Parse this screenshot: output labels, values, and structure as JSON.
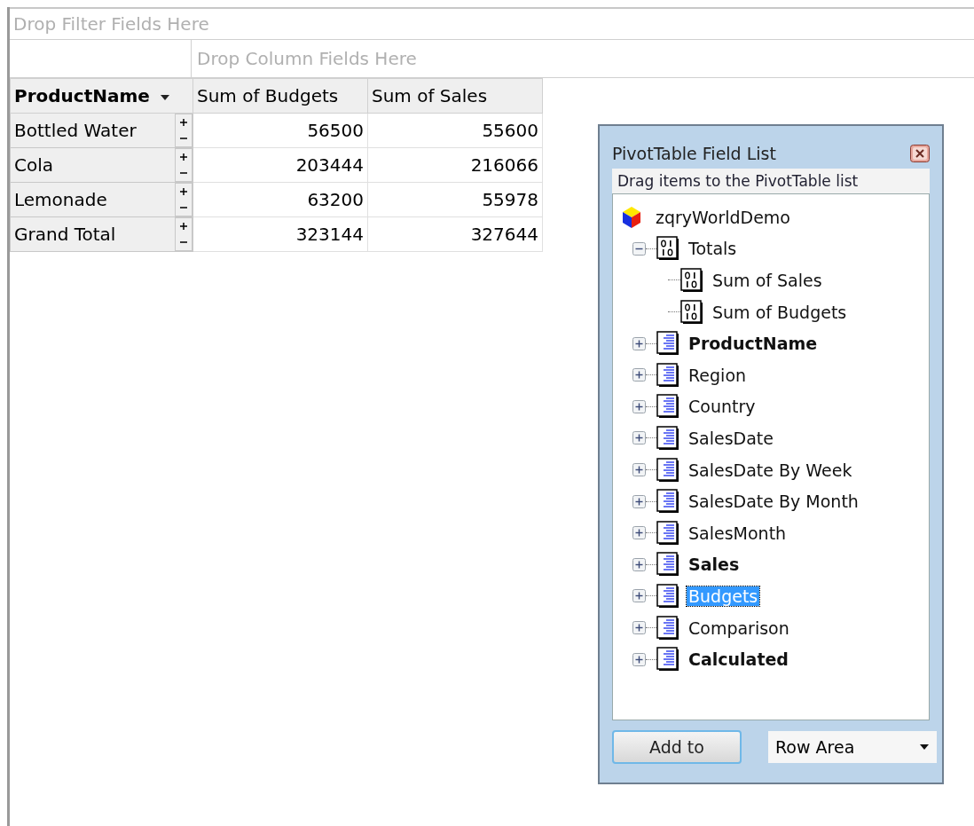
{
  "pivot": {
    "filter_placeholder": "Drop Filter Fields Here",
    "column_placeholder": "Drop Column Fields Here",
    "row_field": "ProductName",
    "columns": [
      "Sum of Budgets",
      "Sum of Sales"
    ],
    "rows": [
      {
        "label": "Bottled Water",
        "values": [
          "56500",
          "55600"
        ]
      },
      {
        "label": "Cola",
        "values": [
          "203444",
          "216066"
        ]
      },
      {
        "label": "Lemonade",
        "values": [
          "63200",
          "55978"
        ]
      },
      {
        "label": "Grand Total",
        "values": [
          "323144",
          "327644"
        ]
      }
    ]
  },
  "field_list": {
    "title": "PivotTable Field List",
    "hint": "Drag items to the PivotTable list",
    "root": {
      "label": "zqryWorldDemo",
      "children": [
        {
          "kind": "measure-group",
          "label": "Totals",
          "expanded": true,
          "bold": false,
          "selected": false,
          "children": [
            {
              "kind": "measure",
              "label": "Sum of Sales",
              "bold": false,
              "selected": false
            },
            {
              "kind": "measure",
              "label": "Sum of Budgets",
              "bold": false,
              "selected": false
            }
          ]
        },
        {
          "kind": "dimension",
          "label": "ProductName",
          "expanded": false,
          "bold": true,
          "selected": false
        },
        {
          "kind": "dimension",
          "label": "Region",
          "expanded": false,
          "bold": false,
          "selected": false
        },
        {
          "kind": "dimension",
          "label": "Country",
          "expanded": false,
          "bold": false,
          "selected": false
        },
        {
          "kind": "dimension",
          "label": "SalesDate",
          "expanded": false,
          "bold": false,
          "selected": false
        },
        {
          "kind": "dimension",
          "label": "SalesDate By Week",
          "expanded": false,
          "bold": false,
          "selected": false
        },
        {
          "kind": "dimension",
          "label": "SalesDate By Month",
          "expanded": false,
          "bold": false,
          "selected": false
        },
        {
          "kind": "dimension",
          "label": "SalesMonth",
          "expanded": false,
          "bold": false,
          "selected": false
        },
        {
          "kind": "dimension",
          "label": "Sales",
          "expanded": false,
          "bold": true,
          "selected": false
        },
        {
          "kind": "dimension",
          "label": "Budgets",
          "expanded": false,
          "bold": false,
          "selected": true
        },
        {
          "kind": "dimension",
          "label": "Comparison",
          "expanded": false,
          "bold": false,
          "selected": false
        },
        {
          "kind": "dimension",
          "label": "Calculated",
          "expanded": false,
          "bold": true,
          "selected": false
        }
      ]
    },
    "add_button": "Add to",
    "area_select": "Row Area"
  }
}
